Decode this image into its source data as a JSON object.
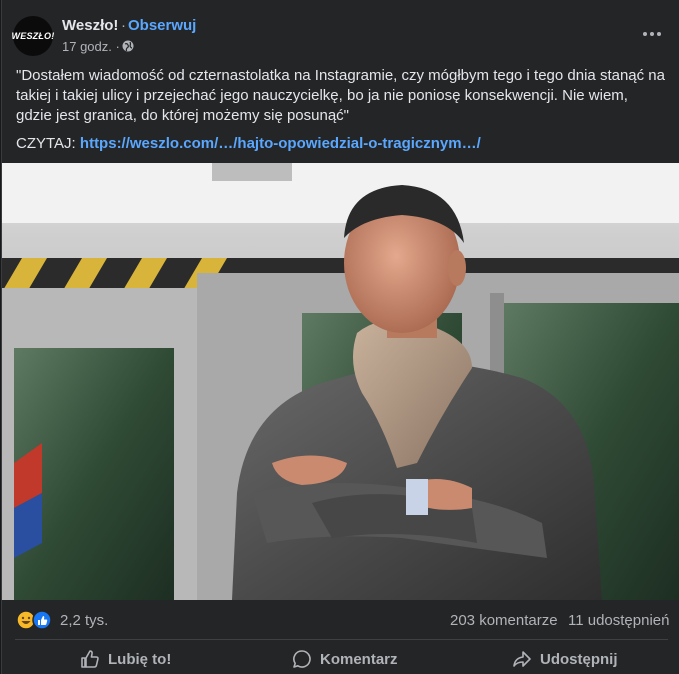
{
  "post": {
    "page_name": "Weszło!",
    "separator": "·",
    "follow_label": "Obserwuj",
    "avatar_text": "WESZŁO!",
    "time": "17 godz. ·",
    "text": "\"Dostałem wiadomość od czternastolatka na Instagramie, czy mógłbym tego i tego dnia stanąć na takiej i takiej ulicy i przejechać jego nauczycielkę, bo ja nie poniosę konsekwencji. Nie wiem, gdzie jest granica, do której możemy się posunąć\"",
    "link_prefix": "CZYTAJ:",
    "link_text": "https://weszlo.com/…/hajto-opowiedzial-o-tragicznym…/"
  },
  "stats": {
    "reactions": "2,2 tys.",
    "comments": "203 komentarze",
    "shares": "11 udostępnień"
  },
  "actions": {
    "like": "Lubię to!",
    "comment": "Komentarz",
    "share": "Udostępnij"
  },
  "icons": {
    "avatar": "weszlo-logo",
    "privacy": "globe-icon",
    "menu": "more-options-icon",
    "reaction_1": "haha-reaction-icon",
    "reaction_2": "like-reaction-icon",
    "like": "thumbs-up-icon",
    "comment": "comment-bubble-icon",
    "share": "share-arrow-icon"
  },
  "colors": {
    "background": "#242526",
    "accent": "#5aa7ff",
    "text": "#e4e6eb",
    "secondary": "#b0b3b8"
  }
}
